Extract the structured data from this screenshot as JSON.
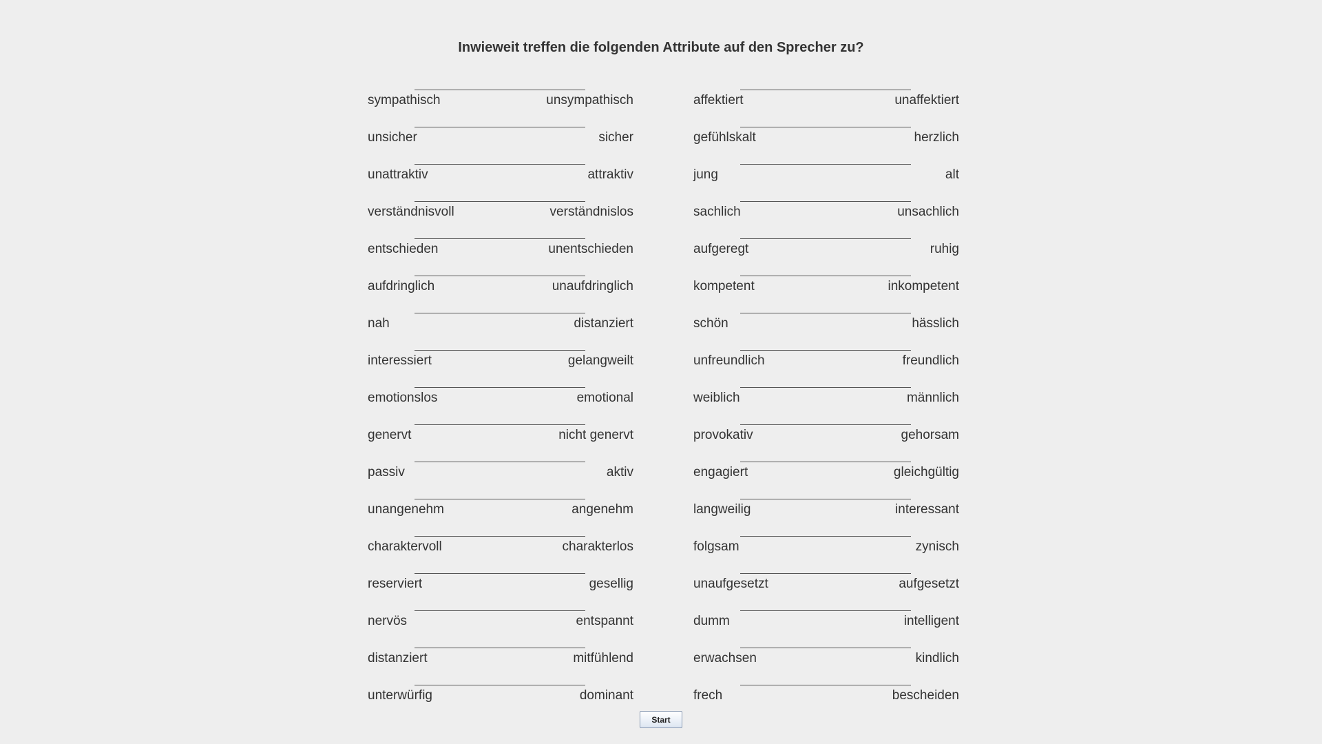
{
  "title": "Inwieweit treffen die folgenden Attribute auf den Sprecher zu?",
  "left_scales": [
    {
      "left": "sympathisch",
      "right": "unsympathisch"
    },
    {
      "left": "unsicher",
      "right": "sicher"
    },
    {
      "left": "unattraktiv",
      "right": "attraktiv"
    },
    {
      "left": "verständnisvoll",
      "right": "verständnislos"
    },
    {
      "left": "entschieden",
      "right": "unentschieden"
    },
    {
      "left": "aufdringlich",
      "right": "unaufdringlich"
    },
    {
      "left": "nah",
      "right": "distanziert"
    },
    {
      "left": "interessiert",
      "right": "gelangweilt"
    },
    {
      "left": "emotionslos",
      "right": "emotional"
    },
    {
      "left": "genervt",
      "right": "nicht genervt"
    },
    {
      "left": "passiv",
      "right": "aktiv"
    },
    {
      "left": "unangenehm",
      "right": "angenehm"
    },
    {
      "left": "charaktervoll",
      "right": "charakterlos"
    },
    {
      "left": "reserviert",
      "right": "gesellig"
    },
    {
      "left": "nervös",
      "right": "entspannt"
    },
    {
      "left": "distanziert",
      "right": "mitfühlend"
    },
    {
      "left": "unterwürfig",
      "right": "dominant"
    }
  ],
  "right_scales": [
    {
      "left": "affektiert",
      "right": "unaffektiert"
    },
    {
      "left": "gefühlskalt",
      "right": "herzlich"
    },
    {
      "left": "jung",
      "right": "alt"
    },
    {
      "left": "sachlich",
      "right": "unsachlich"
    },
    {
      "left": "aufgeregt",
      "right": "ruhig"
    },
    {
      "left": "kompetent",
      "right": "inkompetent"
    },
    {
      "left": "schön",
      "right": "hässlich"
    },
    {
      "left": "unfreundlich",
      "right": "freundlich"
    },
    {
      "left": "weiblich",
      "right": "männlich"
    },
    {
      "left": "provokativ",
      "right": "gehorsam"
    },
    {
      "left": "engagiert",
      "right": "gleichgültig"
    },
    {
      "left": "langweilig",
      "right": "interessant"
    },
    {
      "left": "folgsam",
      "right": "zynisch"
    },
    {
      "left": "unaufgesetzt",
      "right": "aufgesetzt"
    },
    {
      "left": "dumm",
      "right": "intelligent"
    },
    {
      "left": "erwachsen",
      "right": "kindlich"
    },
    {
      "left": "frech",
      "right": "bescheiden"
    }
  ],
  "start_button": "Start"
}
